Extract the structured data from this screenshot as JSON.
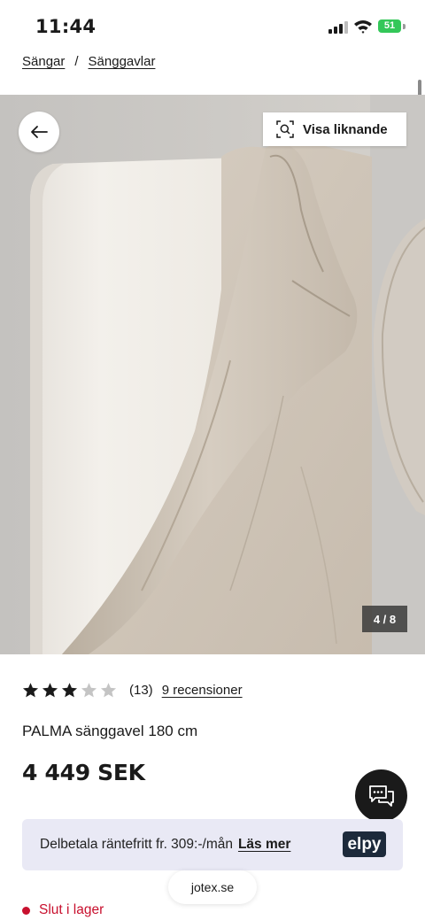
{
  "status_bar": {
    "time": "11:44",
    "battery": "51"
  },
  "breadcrumb": {
    "items": [
      "Sängar",
      "Sänggavlar"
    ],
    "separator": "/"
  },
  "gallery": {
    "similar_label": "Visa liknande",
    "counter": "4 / 8"
  },
  "product": {
    "rating_stars": 3,
    "rating_max": 5,
    "rating_count": "(13)",
    "reviews_link": "9 recensioner",
    "title": "PALMA sänggavel 180 cm",
    "price": "4 449 SEK"
  },
  "financing": {
    "text": "Delbetala räntefritt fr. 309:-/mån",
    "link": "Läs mer",
    "brand": "elpy"
  },
  "stock": {
    "label": "Slut i lager"
  },
  "browser": {
    "url": "jotex.se"
  },
  "colors": {
    "accent": "#1a1a1a",
    "out_of_stock": "#c8102e",
    "financing_bg": "#e9e9f5",
    "elpy_bg": "#1d2a3b"
  }
}
